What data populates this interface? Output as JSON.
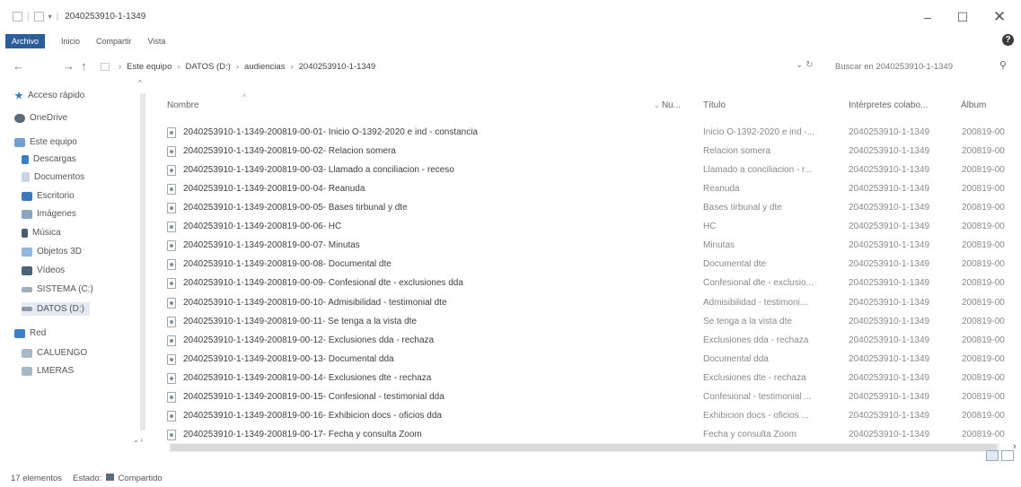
{
  "window": {
    "title": "2040253910-1-1349",
    "min_glyph": "–",
    "max_glyph": "☐",
    "close_glyph": "✕",
    "help_glyph": "?"
  },
  "ribbon": {
    "tabs": [
      "Archivo",
      "Inicio",
      "Compartir",
      "Vista"
    ]
  },
  "nav": {
    "back": "←",
    "forward": "→",
    "up": "↑"
  },
  "address": {
    "crumbs": [
      "Este equipo",
      "DATOS (D:)",
      "audiencias",
      "2040253910-1-1349"
    ],
    "separator": "›",
    "refresh": "↻"
  },
  "search": {
    "placeholder": "Buscar en 2040253910-1-1349",
    "icon": "search-icon"
  },
  "navpane": {
    "items": [
      {
        "label": "Acceso rápido",
        "icon": "star-icon",
        "color": "#3f7fc7"
      },
      {
        "label": "OneDrive",
        "icon": "cloud-icon",
        "color": "#5a6a78"
      },
      {
        "label": "Este equipo",
        "icon": "computer-icon",
        "color": "#6fa0d0"
      },
      {
        "label": "Descargas",
        "icon": "download-icon",
        "color": "#3a7fc9"
      },
      {
        "label": "Documentos",
        "icon": "documents-icon",
        "color": "#c9d5e2"
      },
      {
        "label": "Escritorio",
        "icon": "desktop-icon",
        "color": "#3c7ac0"
      },
      {
        "label": "Imágenes",
        "icon": "pictures-icon",
        "color": "#8aa6c1"
      },
      {
        "label": "Música",
        "icon": "music-icon",
        "color": "#4c5d70"
      },
      {
        "label": "Objetos 3D",
        "icon": "objects-3d-icon",
        "color": "#8fb7df"
      },
      {
        "label": "Vídeos",
        "icon": "videos-icon",
        "color": "#4d6378"
      },
      {
        "label": "SISTEMA (C:)",
        "icon": "drive-icon",
        "color": "#9eaebd"
      },
      {
        "label": "DATOS (D:)",
        "icon": "drive-icon",
        "color": "#8f9ca8"
      },
      {
        "label": "Red",
        "icon": "network-icon",
        "color": "#3f7fc7"
      },
      {
        "label": "CALUENGO",
        "icon": "computer-icon",
        "color": "#a7b8c9"
      },
      {
        "label": "LMERAS",
        "icon": "computer-icon",
        "color": "#a7b8c9"
      }
    ]
  },
  "columns": {
    "name": "Nombre",
    "number": "Nu...",
    "title": "Título",
    "artists": "Intérpretes colabo...",
    "album": "Álbum"
  },
  "files": [
    {
      "name": "2040253910-1-1349-200819-00-01- Inicio O-1392-2020 e ind - constancia",
      "title": "Inicio O-1392-2020 e ind -...",
      "artist": "2040253910-1-1349",
      "album": "200819-00"
    },
    {
      "name": "2040253910-1-1349-200819-00-02- Relacion somera",
      "title": "Relacion somera",
      "artist": "2040253910-1-1349",
      "album": "200819-00"
    },
    {
      "name": "2040253910-1-1349-200819-00-03- Llamado a conciliacion - receso",
      "title": "Llamado a conciliacion - r...",
      "artist": "2040253910-1-1349",
      "album": "200819-00"
    },
    {
      "name": "2040253910-1-1349-200819-00-04- Reanuda",
      "title": "Reanuda",
      "artist": "2040253910-1-1349",
      "album": "200819-00"
    },
    {
      "name": "2040253910-1-1349-200819-00-05- Bases tirbunal y dte",
      "title": "Bases tirbunal y dte",
      "artist": "2040253910-1-1349",
      "album": "200819-00"
    },
    {
      "name": "2040253910-1-1349-200819-00-06- HC",
      "title": "HC",
      "artist": "2040253910-1-1349",
      "album": "200819-00"
    },
    {
      "name": "2040253910-1-1349-200819-00-07- Minutas",
      "title": "Minutas",
      "artist": "2040253910-1-1349",
      "album": "200819-00"
    },
    {
      "name": "2040253910-1-1349-200819-00-08- Documental dte",
      "title": "Documental dte",
      "artist": "2040253910-1-1349",
      "album": "200819-00"
    },
    {
      "name": "2040253910-1-1349-200819-00-09- Confesional dte - exclusiones dda",
      "title": "Confesional dte - exclusio...",
      "artist": "2040253910-1-1349",
      "album": "200819-00"
    },
    {
      "name": "2040253910-1-1349-200819-00-10- Admisibilidad - testimonial dte",
      "title": "Admisibilidad - testimoni...",
      "artist": "2040253910-1-1349",
      "album": "200819-00"
    },
    {
      "name": "2040253910-1-1349-200819-00-11- Se tenga a la vista dte",
      "title": "Se tenga a la vista dte",
      "artist": "2040253910-1-1349",
      "album": "200819-00"
    },
    {
      "name": "2040253910-1-1349-200819-00-12- Exclusiones dda - rechaza",
      "title": "Exclusiones dda - rechaza",
      "artist": "2040253910-1-1349",
      "album": "200819-00"
    },
    {
      "name": "2040253910-1-1349-200819-00-13- Documental dda",
      "title": "Documental dda",
      "artist": "2040253910-1-1349",
      "album": "200819-00"
    },
    {
      "name": "2040253910-1-1349-200819-00-14- Exclusiones dte - rechaza",
      "title": "Exclusiones dte - rechaza",
      "artist": "2040253910-1-1349",
      "album": "200819-00"
    },
    {
      "name": "2040253910-1-1349-200819-00-15- Confesional - testimonial dda",
      "title": "Confesional - testimonial ...",
      "artist": "2040253910-1-1349",
      "album": "200819-00"
    },
    {
      "name": "2040253910-1-1349-200819-00-16- Exhibicion docs - oficios dda",
      "title": "Exhibicion docs - oficios ...",
      "artist": "2040253910-1-1349",
      "album": "200819-00"
    },
    {
      "name": "2040253910-1-1349-200819-00-17- Fecha y consulta Zoom",
      "title": "Fecha y consulta Zoom",
      "artist": "2040253910-1-1349",
      "album": "200819-00"
    }
  ],
  "status": {
    "count": "17 elementos",
    "state_label": "Estado:",
    "state_value": "Compartido"
  }
}
